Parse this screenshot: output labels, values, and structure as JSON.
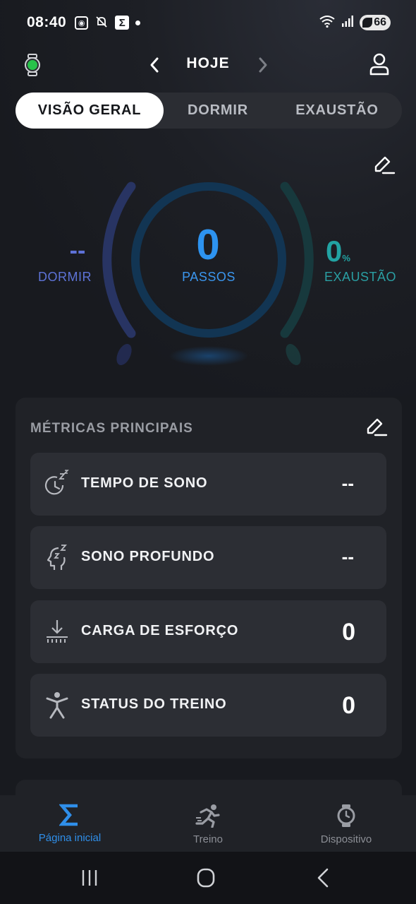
{
  "status_bar": {
    "time": "08:40",
    "battery": "66",
    "icons": [
      "screenshot-icon",
      "notifications-off-icon",
      "sigma-app-icon",
      "dot-icon",
      "wifi-icon",
      "signal-icon",
      "battery-icon"
    ]
  },
  "header": {
    "date_label": "HOJE",
    "icons": [
      "watch-connected-icon",
      "chevron-left-icon",
      "chevron-right-icon",
      "profile-icon"
    ]
  },
  "tabs": [
    {
      "label": "VISÃO GERAL",
      "active": true
    },
    {
      "label": "DORMIR",
      "active": false
    },
    {
      "label": "EXAUSTÃO",
      "active": false
    }
  ],
  "gauge": {
    "left": {
      "value": "--",
      "label": "DORMIR",
      "color": "#5e72d8"
    },
    "center": {
      "value": "0",
      "label": "PASSOS",
      "color": "#2d93f0"
    },
    "right": {
      "value": "0",
      "unit": "%",
      "label": "EXAUSTÃO",
      "color": "#22a3a3"
    }
  },
  "metrics_card": {
    "title": "MÉTRICAS PRINCIPAIS",
    "items": [
      {
        "label": "TEMPO DE SONO",
        "value": "--",
        "icon": "sleep-clock-icon"
      },
      {
        "label": "SONO PROFUNDO",
        "value": "--",
        "icon": "deep-sleep-head-icon"
      },
      {
        "label": "CARGA DE ESFORÇO",
        "value": "0",
        "icon": "effort-load-icon"
      },
      {
        "label": "STATUS DO TREINO",
        "value": "0",
        "icon": "training-person-icon"
      }
    ]
  },
  "bottom_nav": [
    {
      "label": "Página inicial",
      "icon": "sigma-home-icon",
      "active": true
    },
    {
      "label": "Treino",
      "icon": "running-icon",
      "active": false
    },
    {
      "label": "Dispositivo",
      "icon": "watch-device-icon",
      "active": false
    }
  ],
  "colors": {
    "background": "#181a1f",
    "card": "#202227",
    "metric_row": "#2c2e34",
    "accent_blue": "#2f8fea"
  }
}
